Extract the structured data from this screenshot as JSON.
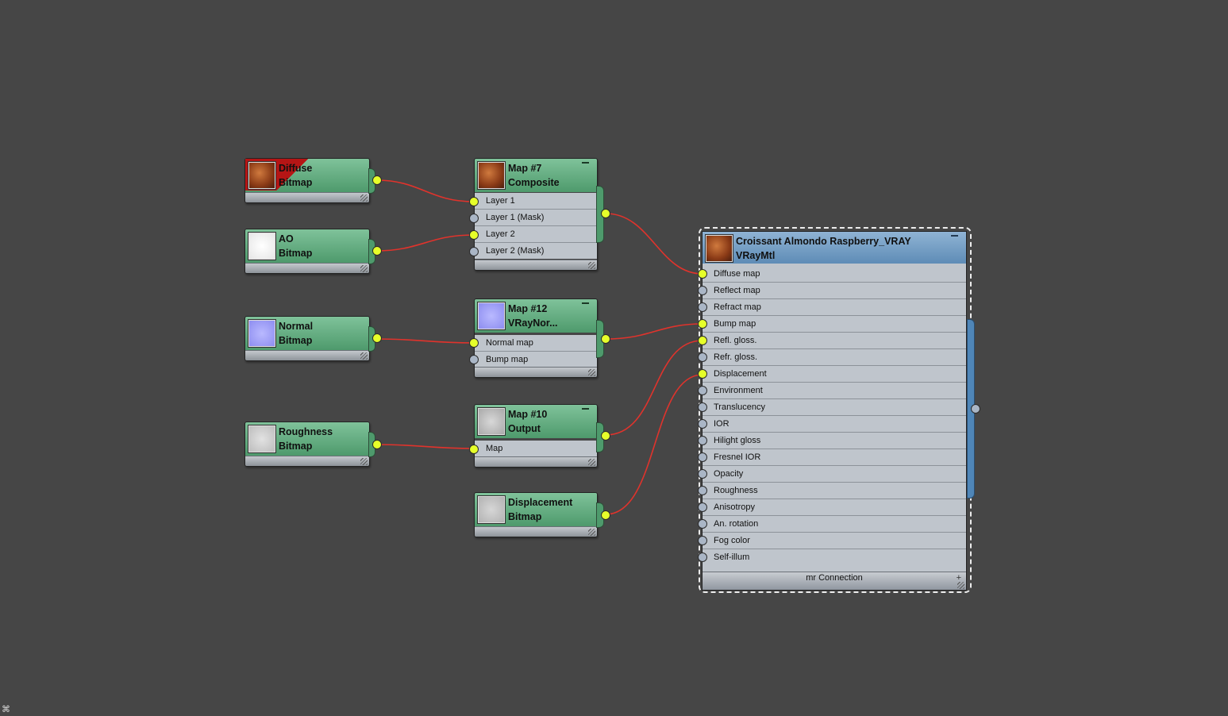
{
  "nodes": {
    "diffuse": {
      "title1": "Diffuse",
      "title2": "Bitmap"
    },
    "ao": {
      "title1": "AO",
      "title2": "Bitmap"
    },
    "normal": {
      "title1": "Normal",
      "title2": "Bitmap"
    },
    "roughness": {
      "title1": "Roughness",
      "title2": "Bitmap"
    },
    "map7": {
      "title1": "Map #7",
      "title2": "Composite",
      "slots": [
        "Layer 1",
        "Layer 1 (Mask)",
        "Layer 2",
        "Layer 2 (Mask)"
      ]
    },
    "map12": {
      "title1": "Map #12",
      "title2": "VRayNor...",
      "slots": [
        "Normal map",
        "Bump map"
      ]
    },
    "map10": {
      "title1": "Map #10",
      "title2": "Output",
      "slots": [
        "Map"
      ]
    },
    "displacement": {
      "title1": "Displacement",
      "title2": "Bitmap"
    }
  },
  "material": {
    "title1": "Croissant Almondo Raspberry_VRAY",
    "title2": "VRayMtl",
    "slots": [
      "Diffuse map",
      "Reflect map",
      "Refract map",
      "Bump map",
      "Refl. gloss.",
      "Refr. gloss.",
      "Displacement",
      "Environment",
      "Translucency",
      "IOR",
      "Hilight gloss",
      "Fresnel IOR",
      "Opacity",
      "Roughness",
      "Anisotropy",
      "An. rotation",
      "Fog color",
      "Self-illum"
    ],
    "connected": [
      true,
      false,
      false,
      true,
      true,
      false,
      true,
      false,
      false,
      false,
      false,
      false,
      false,
      false,
      false,
      false,
      false,
      false
    ],
    "footer": "mr Connection"
  },
  "colors": {
    "canvas": "#464646",
    "wire": "#e0332c",
    "map_node": "#5ea97b",
    "material_node": "#6f9cc4",
    "port_connected": "#e6ff2a",
    "port_empty": "#aab6c6"
  }
}
